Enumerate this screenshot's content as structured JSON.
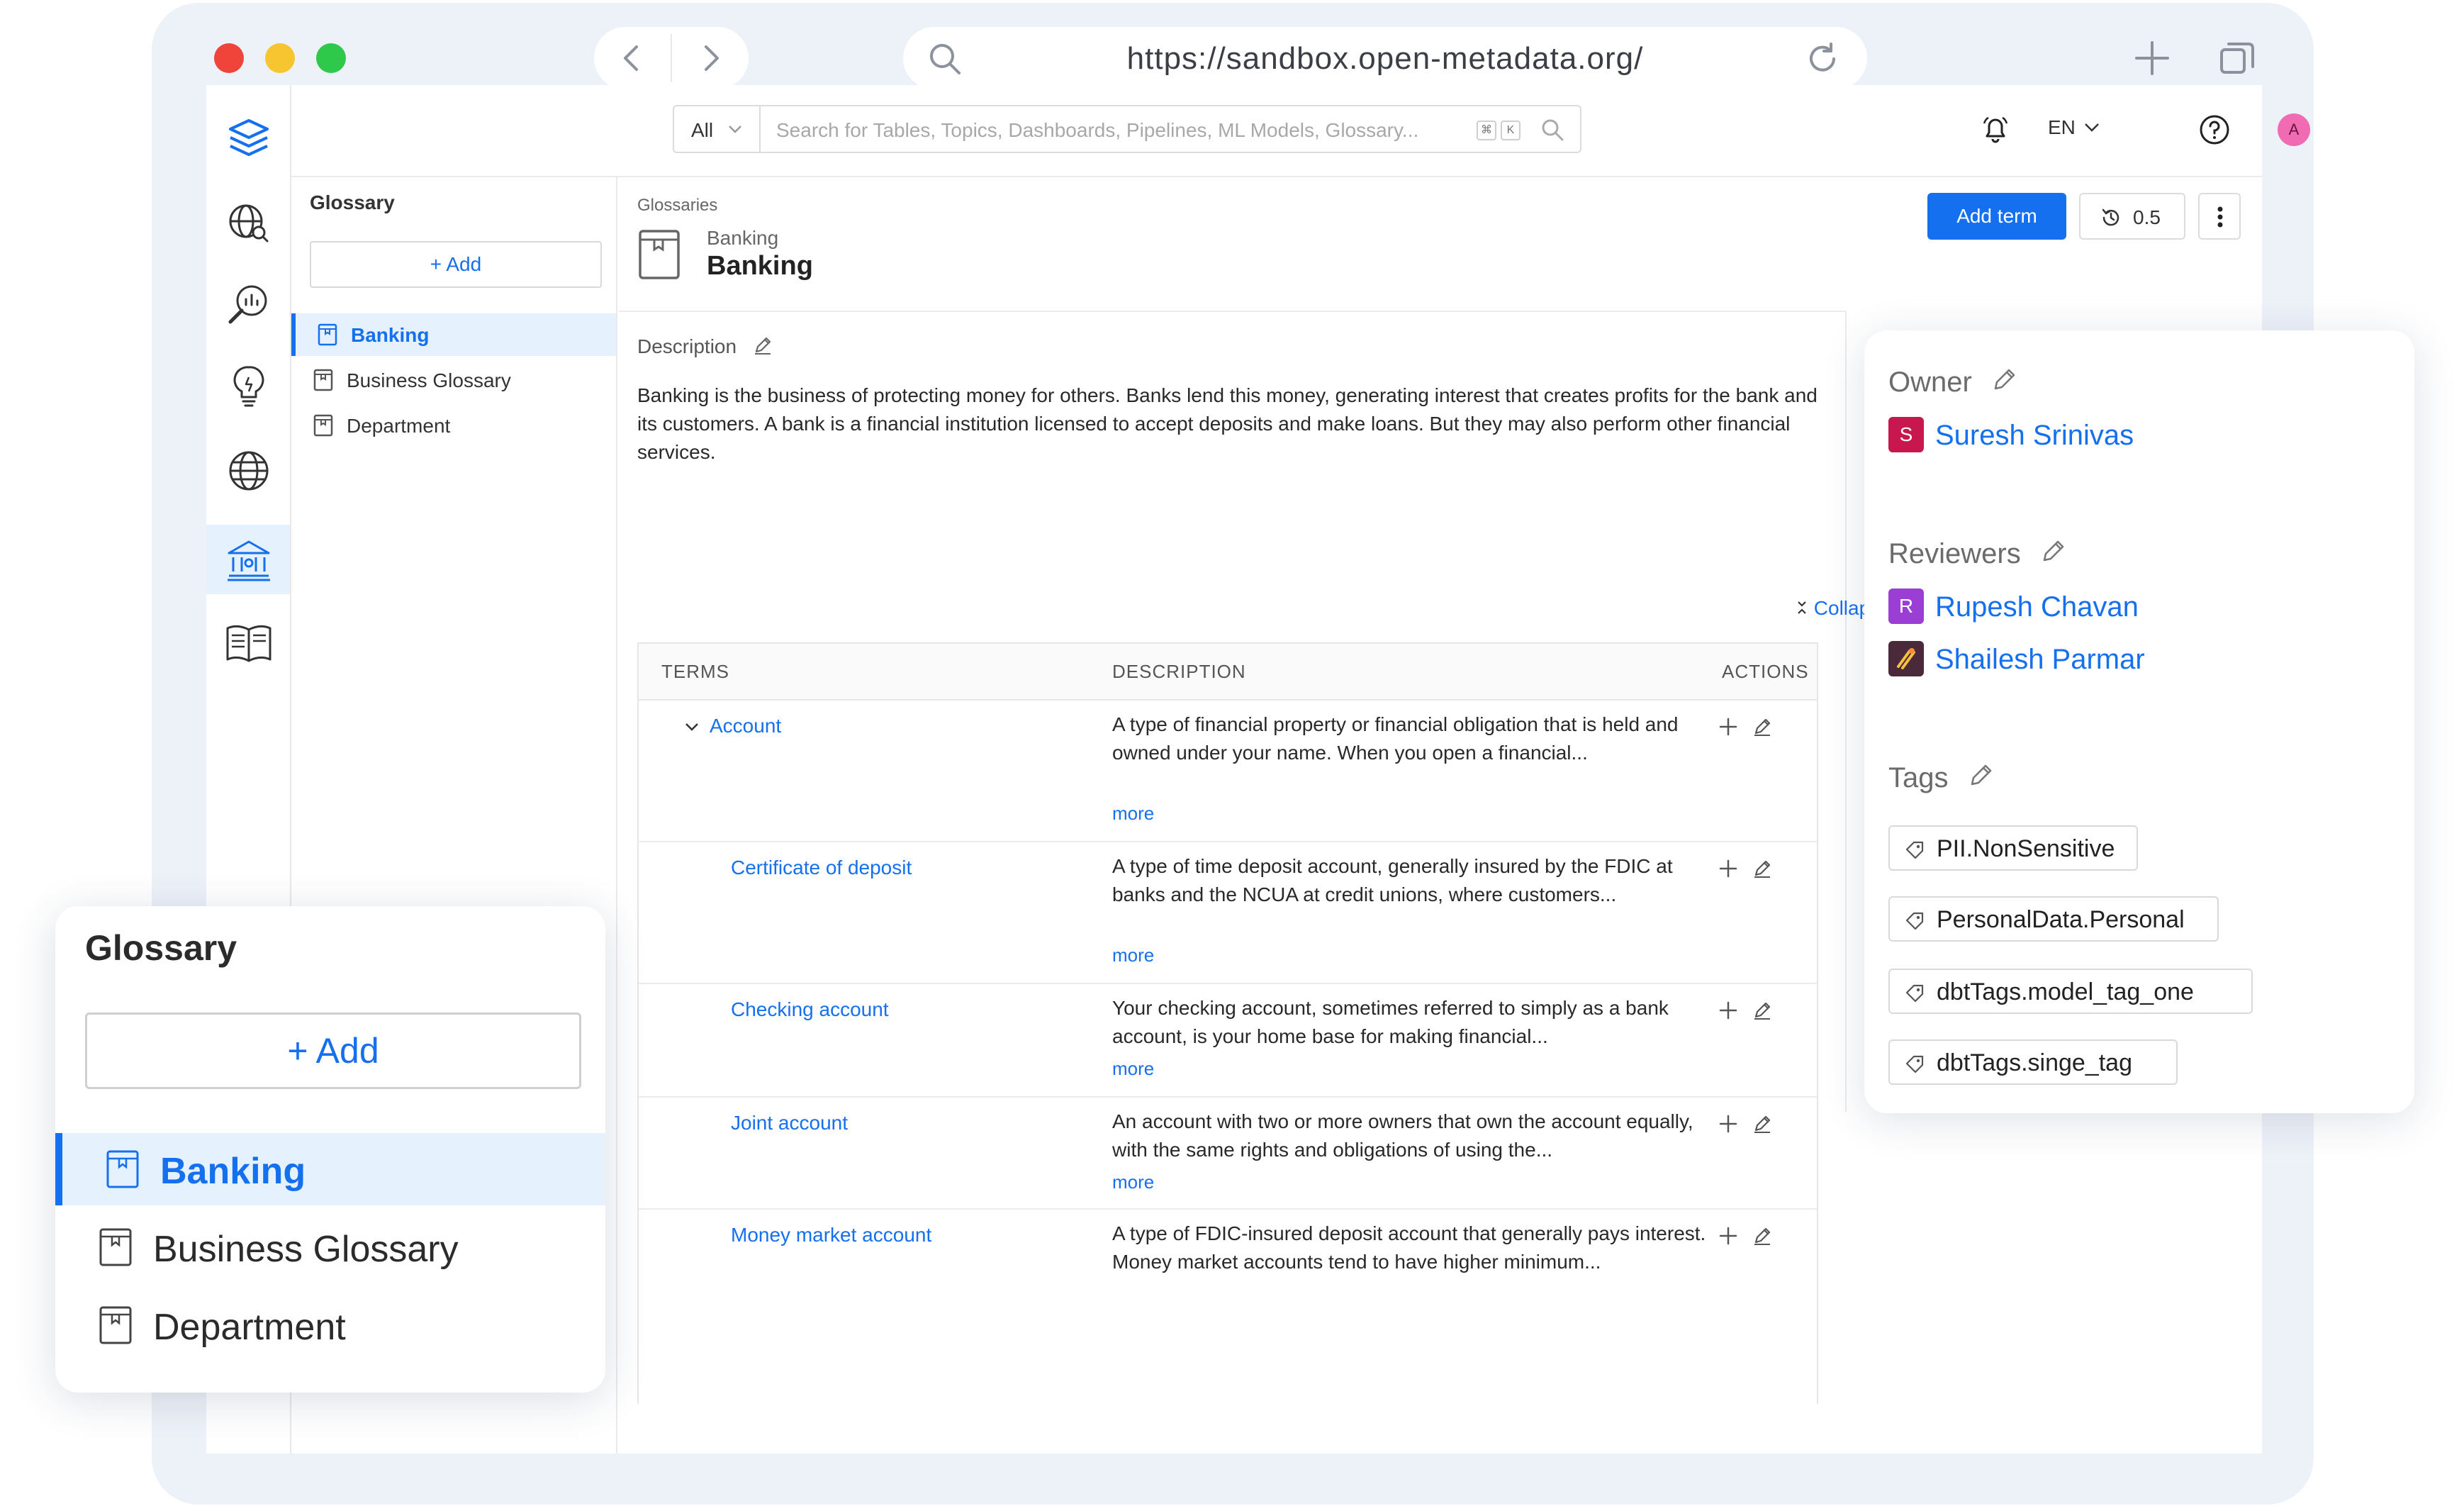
{
  "browser": {
    "url": "https://sandbox.open-metadata.org/"
  },
  "topbar": {
    "search_scope": "All",
    "search_placeholder": "Search for Tables, Topics, Dashboards, Pipelines, ML Models, Glossary...",
    "kbd_cmd": "⌘",
    "kbd_k": "K",
    "language": "EN",
    "user_initial": "A"
  },
  "glossary_panel": {
    "title": "Glossary",
    "add_label": "+ Add",
    "items": [
      {
        "label": "Banking",
        "selected": true
      },
      {
        "label": "Business Glossary",
        "selected": false
      },
      {
        "label": "Department",
        "selected": false
      }
    ]
  },
  "main": {
    "breadcrumb": "Glossaries",
    "subtitle": "Banking",
    "title": "Banking",
    "add_term_label": "Add term",
    "version": "0.5",
    "description_label": "Description",
    "description": "Banking is the business of protecting money for others. Banks lend this money, generating interest that creates profits for the bank and its customers. A bank is a financial institution licensed to accept deposits and make loans. But they may also perform other financial services.",
    "collapse_all": "Collapse All"
  },
  "terms_table": {
    "columns": [
      "TERMS",
      "DESCRIPTION",
      "ACTIONS"
    ],
    "more_label": "more",
    "rows": [
      {
        "name": "Account",
        "description": "A type of financial property or financial obligation that is held and owned under your name. When you open a financial...",
        "has_more": true
      },
      {
        "name": "Certificate of deposit",
        "description": "A type of time deposit account, generally insured by the FDIC at banks and the NCUA at credit unions, where customers...",
        "has_more": true
      },
      {
        "name": "Checking account",
        "description": "Your checking account, sometimes referred to simply as a bank account, is your home base for making financial...",
        "has_more": true
      },
      {
        "name": "Joint account",
        "description": "An account with two or more owners that own the account equally, with the same rights and obligations of using the...",
        "has_more": true
      },
      {
        "name": "Money market account",
        "description": "A type of FDIC-insured deposit account that generally pays interest. Money market accounts tend to have higher minimum...",
        "has_more": false
      }
    ]
  },
  "details_card": {
    "owner_label": "Owner",
    "owner": {
      "initial": "S",
      "name": "Suresh Srinivas",
      "color": "#c8174f"
    },
    "reviewers_label": "Reviewers",
    "reviewers": [
      {
        "initial": "R",
        "name": "Rupesh Chavan",
        "color": "#9b3fd4"
      },
      {
        "initial": "",
        "name": "Shailesh Parmar",
        "color": "#4a2a3a"
      }
    ],
    "tags_label": "Tags",
    "tags": [
      "PII.NonSensitive",
      "PersonalData.Personal",
      "dbtTags.model_tag_one",
      "dbtTags.singe_tag"
    ]
  },
  "colors": {
    "accent": "#1570ef",
    "selected_bg": "#e6f1fe",
    "frame_bg": "#edf1f8"
  }
}
